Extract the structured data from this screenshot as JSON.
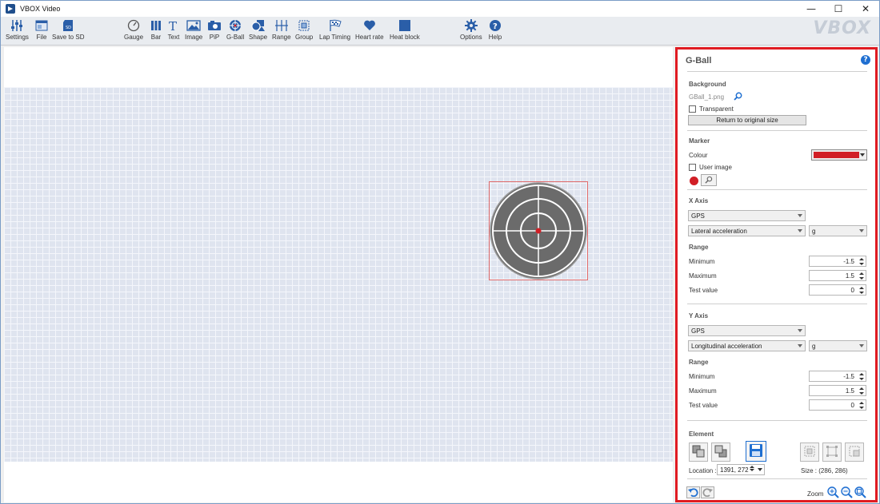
{
  "window": {
    "title": "VBOX Video",
    "logo": "VBOX"
  },
  "toolbar": {
    "items": [
      {
        "label": "Settings",
        "icon": "sliders-icon"
      },
      {
        "label": "File",
        "icon": "file-icon"
      },
      {
        "label": "Save to SD",
        "icon": "sd-card-icon"
      },
      {
        "label": "Gauge",
        "icon": "gauge-icon"
      },
      {
        "label": "Bar",
        "icon": "bar-icon"
      },
      {
        "label": "Text",
        "icon": "text-icon"
      },
      {
        "label": "Image",
        "icon": "image-icon"
      },
      {
        "label": "PiP",
        "icon": "camera-icon"
      },
      {
        "label": "G-Ball",
        "icon": "g-ball-icon"
      },
      {
        "label": "Shape",
        "icon": "shape-icon"
      },
      {
        "label": "Range",
        "icon": "range-icon"
      },
      {
        "label": "Group",
        "icon": "group-icon"
      },
      {
        "label": "Lap Timing",
        "icon": "checkered-flag-icon"
      },
      {
        "label": "Heart rate",
        "icon": "heart-icon"
      },
      {
        "label": "Heat block",
        "icon": "heat-block-icon"
      },
      {
        "label": "Options",
        "icon": "gear-icon"
      },
      {
        "label": "Help",
        "icon": "help-icon"
      }
    ]
  },
  "panel": {
    "title": "G-Ball",
    "background": {
      "heading": "Background",
      "file": "GBall_1.png",
      "transparent_label": "Transparent",
      "transparent_checked": false,
      "reset_label": "Return to original size"
    },
    "marker": {
      "heading": "Marker",
      "colour_label": "Colour",
      "colour": "#d11f26",
      "user_image_label": "User image",
      "user_image_checked": false
    },
    "x_axis": {
      "heading": "X Axis",
      "source": "GPS",
      "channel": "Lateral acceleration",
      "unit": "g",
      "range_heading": "Range",
      "minimum_label": "Minimum",
      "minimum": "-1.5",
      "maximum_label": "Maximum",
      "maximum": "1.5",
      "test_label": "Test value",
      "test": "0"
    },
    "y_axis": {
      "heading": "Y Axis",
      "source": "GPS",
      "channel": "Longitudinal acceleration",
      "unit": "g",
      "range_heading": "Range",
      "minimum_label": "Minimum",
      "minimum": "-1.5",
      "maximum_label": "Maximum",
      "maximum": "1.5",
      "test_label": "Test value",
      "test": "0"
    },
    "element": {
      "heading": "Element",
      "location_label": "Location :",
      "location": "1391, 272",
      "size_label": "Size : (286, 286)"
    },
    "footer": {
      "zoom_label": "Zoom"
    }
  },
  "colors": {
    "accent": "#1f6fd1",
    "highlight_border": "#e01b22",
    "marker": "#d11f26"
  }
}
